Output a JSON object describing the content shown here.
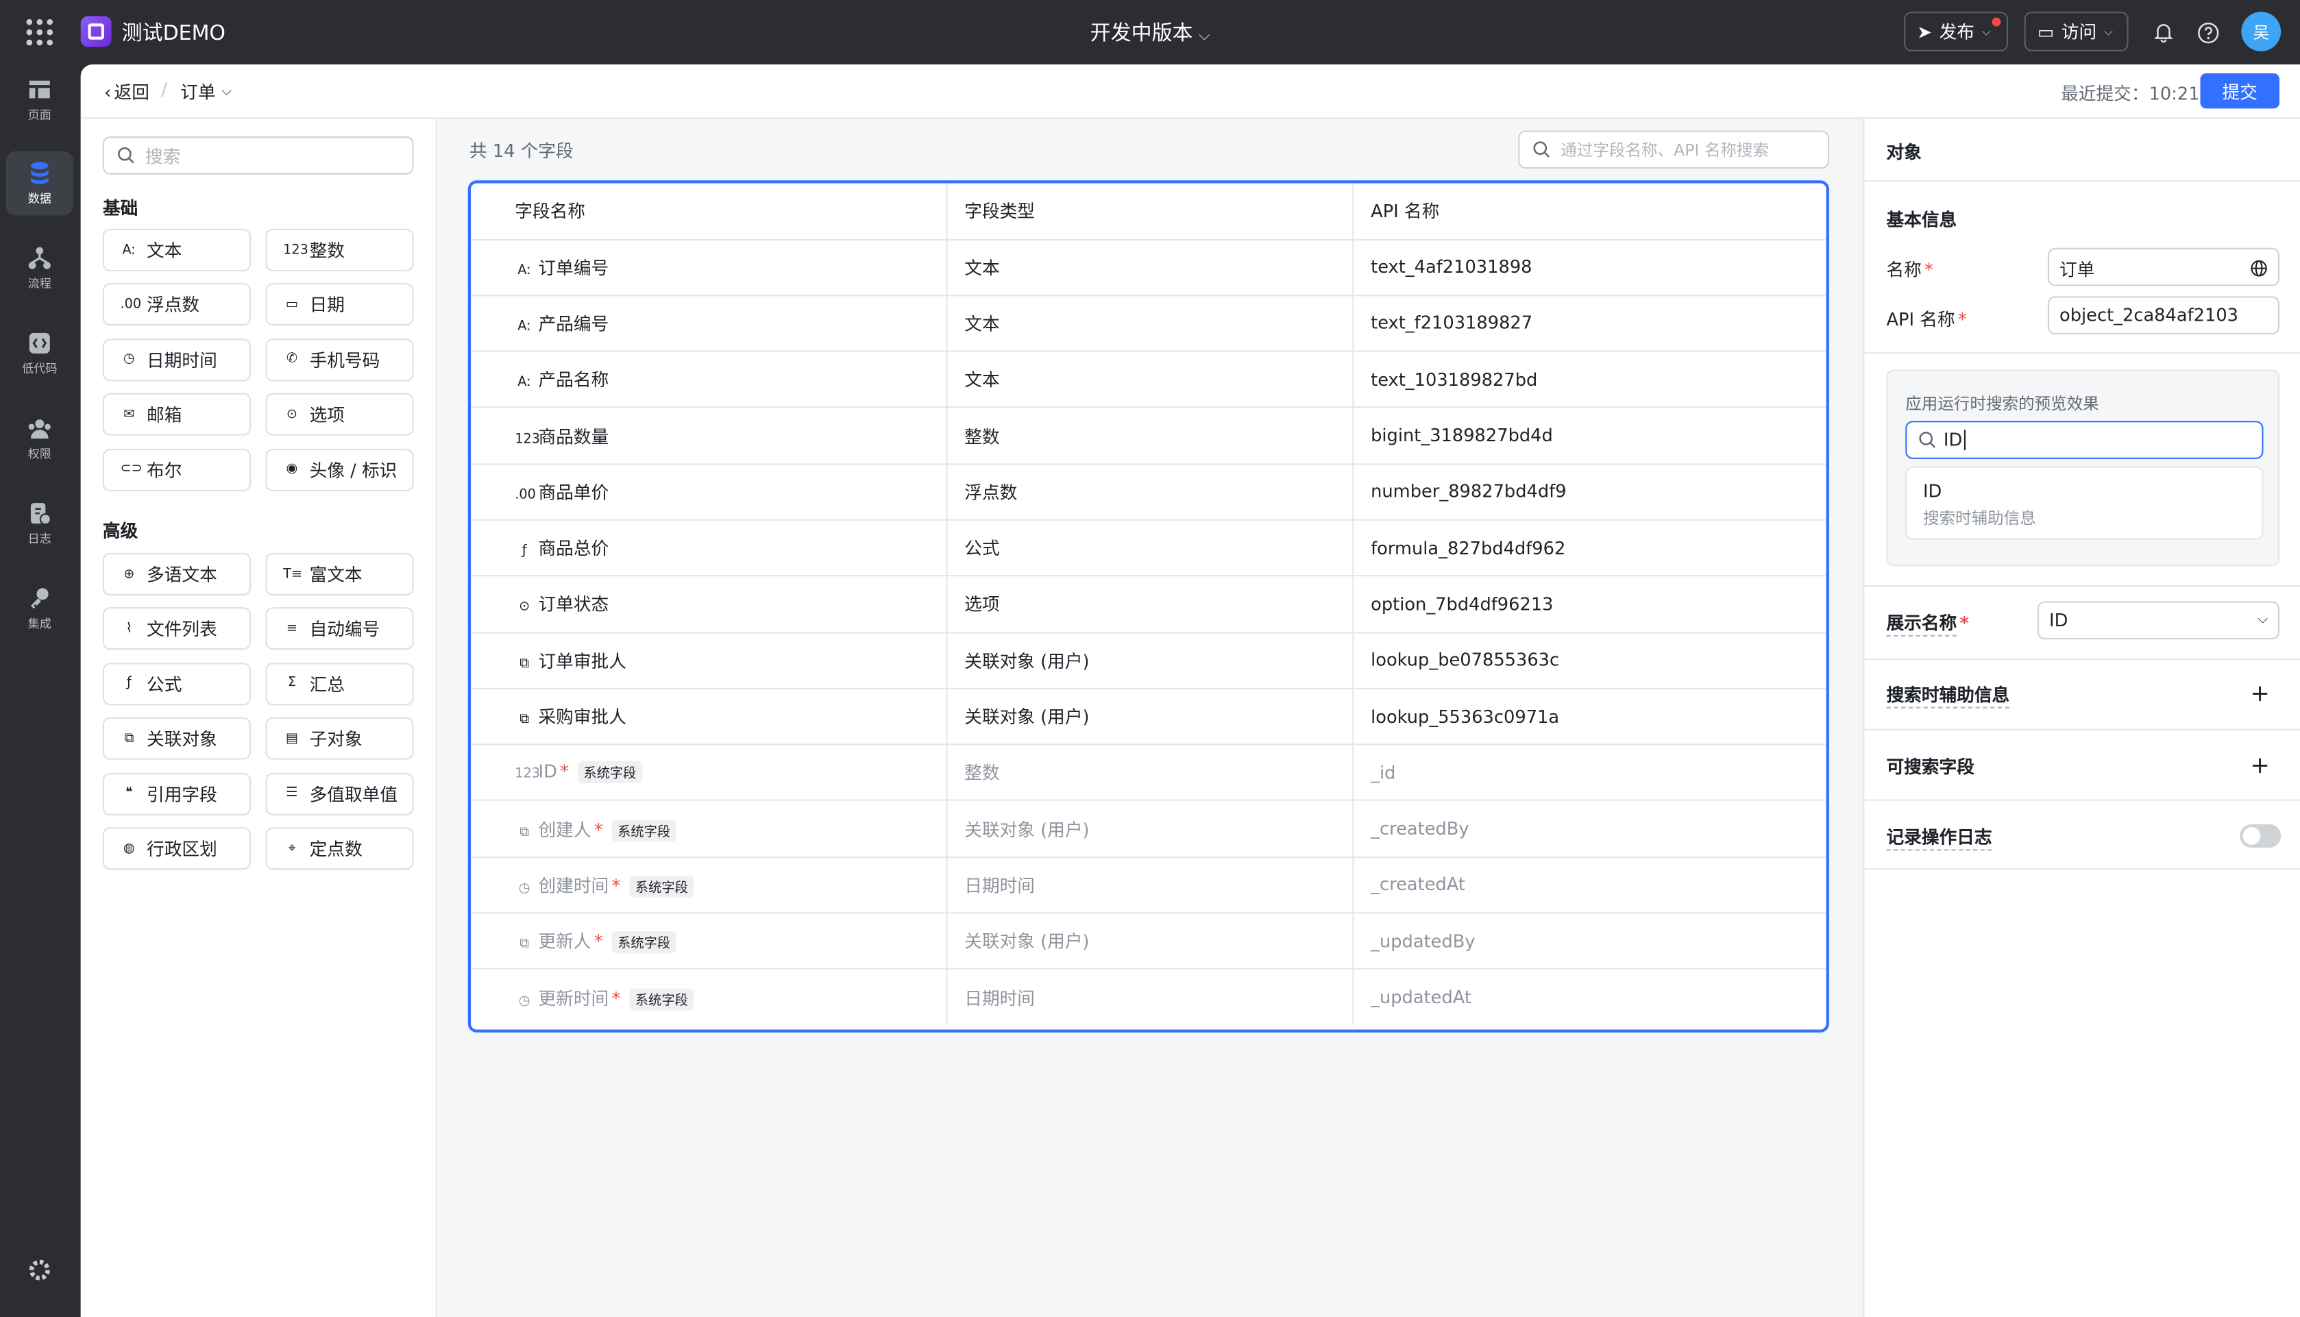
{
  "topbar": {
    "app_name": "测试DEMO",
    "version_label": "开发中版本",
    "publish_label": "发布",
    "visit_label": "访问",
    "user_initial": "吴"
  },
  "nav": [
    {
      "label": "页面",
      "icon": "page-icon"
    },
    {
      "label": "数据",
      "icon": "database-icon",
      "active": true
    },
    {
      "label": "流程",
      "icon": "flow-icon"
    },
    {
      "label": "低代码",
      "icon": "code-icon"
    },
    {
      "label": "权限",
      "icon": "users-icon"
    },
    {
      "label": "日志",
      "icon": "log-icon"
    },
    {
      "label": "集成",
      "icon": "key-icon"
    }
  ],
  "subbar": {
    "back_label": "返回",
    "crumb_label": "订单",
    "last_submit_label": "最近提交：",
    "last_submit_time": "10:21",
    "submit_label": "提交"
  },
  "palette": {
    "search_placeholder": "搜索",
    "basic_title": "基础",
    "basic": [
      {
        "icon": "Aː",
        "label": "文本"
      },
      {
        "icon": "123",
        "label": "整数"
      },
      {
        "icon": ".00",
        "label": "浮点数"
      },
      {
        "icon": "▭",
        "label": "日期"
      },
      {
        "icon": "◷",
        "label": "日期时间"
      },
      {
        "icon": "✆",
        "label": "手机号码"
      },
      {
        "icon": "✉",
        "label": "邮箱"
      },
      {
        "icon": "⊙",
        "label": "选项"
      },
      {
        "icon": "⊂⊃",
        "label": "布尔"
      },
      {
        "icon": "◉",
        "label": "头像 / 标识"
      }
    ],
    "advanced_title": "高级",
    "advanced": [
      {
        "icon": "⊕",
        "label": "多语文本"
      },
      {
        "icon": "T≡",
        "label": "富文本"
      },
      {
        "icon": "⌇",
        "label": "文件列表"
      },
      {
        "icon": "≡",
        "label": "自动编号"
      },
      {
        "icon": "ƒ",
        "label": "公式"
      },
      {
        "icon": "Σ",
        "label": "汇总"
      },
      {
        "icon": "⧉",
        "label": "关联对象"
      },
      {
        "icon": "▤",
        "label": "子对象"
      },
      {
        "icon": "❝",
        "label": "引用字段"
      },
      {
        "icon": "☰",
        "label": "多值取单值"
      },
      {
        "icon": "◍",
        "label": "行政区划"
      },
      {
        "icon": "⌖",
        "label": "定点数"
      }
    ]
  },
  "fields": {
    "count_label": "共 14 个字段",
    "search_placeholder": "通过字段名称、API 名称搜索",
    "columns": [
      "字段名称",
      "字段类型",
      "API 名称"
    ],
    "system_tag": "系统字段",
    "rows": [
      {
        "icon": "Aː",
        "name": "订单编号",
        "type": "文本",
        "api": "text_4af21031898"
      },
      {
        "icon": "Aː",
        "name": "产品编号",
        "type": "文本",
        "api": "text_f2103189827"
      },
      {
        "icon": "Aː",
        "name": "产品名称",
        "type": "文本",
        "api": "text_103189827bd"
      },
      {
        "icon": "123",
        "name": "商品数量",
        "type": "整数",
        "api": "bigint_3189827bd4d"
      },
      {
        "icon": ".00",
        "name": "商品单价",
        "type": "浮点数",
        "api": "number_89827bd4df9"
      },
      {
        "icon": "ƒ",
        "name": "商品总价",
        "type": "公式",
        "api": "formula_827bd4df962"
      },
      {
        "icon": "⊙",
        "name": "订单状态",
        "type": "选项",
        "api": "option_7bd4df96213"
      },
      {
        "icon": "⧉",
        "name": "订单审批人",
        "type": "关联对象 (用户)",
        "api": "lookup_be07855363c"
      },
      {
        "icon": "⧉",
        "name": "采购审批人",
        "type": "关联对象 (用户)",
        "api": "lookup_55363c0971a"
      },
      {
        "icon": "123",
        "name": "ID",
        "type": "整数",
        "api": "_id",
        "system": true
      },
      {
        "icon": "⧉",
        "name": "创建人",
        "type": "关联对象 (用户)",
        "api": "_createdBy",
        "system": true
      },
      {
        "icon": "◷",
        "name": "创建时间",
        "type": "日期时间",
        "api": "_createdAt",
        "system": true
      },
      {
        "icon": "⧉",
        "name": "更新人",
        "type": "关联对象 (用户)",
        "api": "_updatedBy",
        "system": true
      },
      {
        "icon": "◷",
        "name": "更新时间",
        "type": "日期时间",
        "api": "_updatedAt",
        "system": true
      }
    ]
  },
  "panel": {
    "title": "对象",
    "basic_info": "基本信息",
    "name_label": "名称",
    "name_value": "订单",
    "api_label": "API 名称",
    "api_value": "object_2ca84af2103",
    "preview_title": "应用运行时搜索的预览效果",
    "preview_query": "ID",
    "preview_result_title": "ID",
    "preview_result_sub": "搜索时辅助信息",
    "display_name_label": "展示名称",
    "display_name_value": "ID",
    "search_aux_label": "搜索时辅助信息",
    "searchable_label": "可搜索字段",
    "log_label": "记录操作日志"
  },
  "colors": {
    "accent": "#3370ff",
    "required": "#f54a45",
    "sidebar": "#2b2d31"
  }
}
